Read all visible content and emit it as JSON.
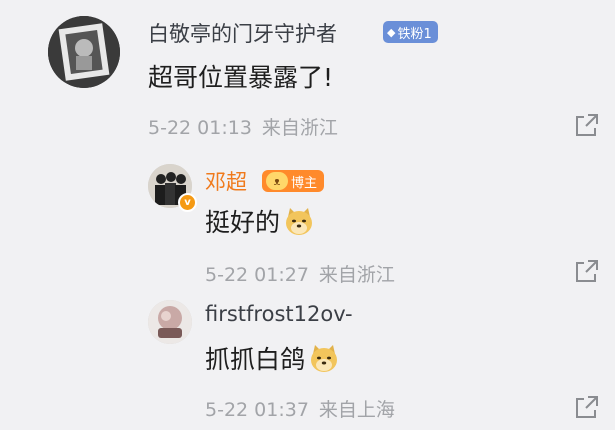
{
  "comments": [
    {
      "username": "白敬亭的门牙守护者",
      "badge": {
        "icon": "diamond-icon",
        "label": "铁粉1",
        "color": "#6a8fd8"
      },
      "text": "超哥位置暴露了!",
      "timestamp": "5-22 01:13",
      "location": "来自浙江",
      "action_icon": "share-icon"
    },
    {
      "username": "邓超",
      "verified_icon": "verified-v-icon",
      "badge": {
        "icon": "dog-paw-icon",
        "label": "博主",
        "color": "#ff8a2b"
      },
      "text": "挺好的",
      "emoji": "doge-emoji-icon",
      "timestamp": "5-22 01:27",
      "location": "来自浙江",
      "action_icon": "share-icon"
    },
    {
      "username": "firstfrost12ov-",
      "text": "抓抓白鸽",
      "emoji": "doge-emoji-icon",
      "timestamp": "5-22 01:37",
      "location": "来自上海",
      "action_icon": "share-icon"
    }
  ]
}
